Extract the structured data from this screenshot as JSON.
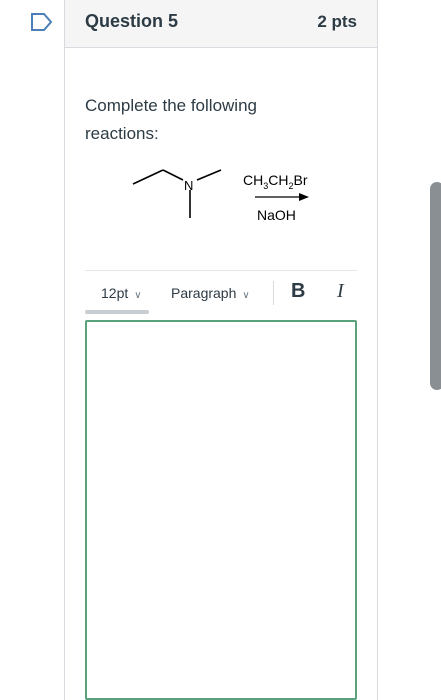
{
  "question": {
    "title": "Question 5",
    "points": "2 pts",
    "prompt": "Complete the following reactions:",
    "flag_icon": "flag-outline-icon"
  },
  "reaction": {
    "reagent_top": "CH3CH2Br",
    "reagent_bottom": "NaOH",
    "nitrogen_label": "N"
  },
  "editor": {
    "font_size": "12pt",
    "block_format": "Paragraph",
    "bold_label": "B",
    "italic_label": "I",
    "value": ""
  },
  "colors": {
    "editor_border": "#5aa27c",
    "header_bg": "#f5f5f5",
    "text": "#2d3b45"
  }
}
